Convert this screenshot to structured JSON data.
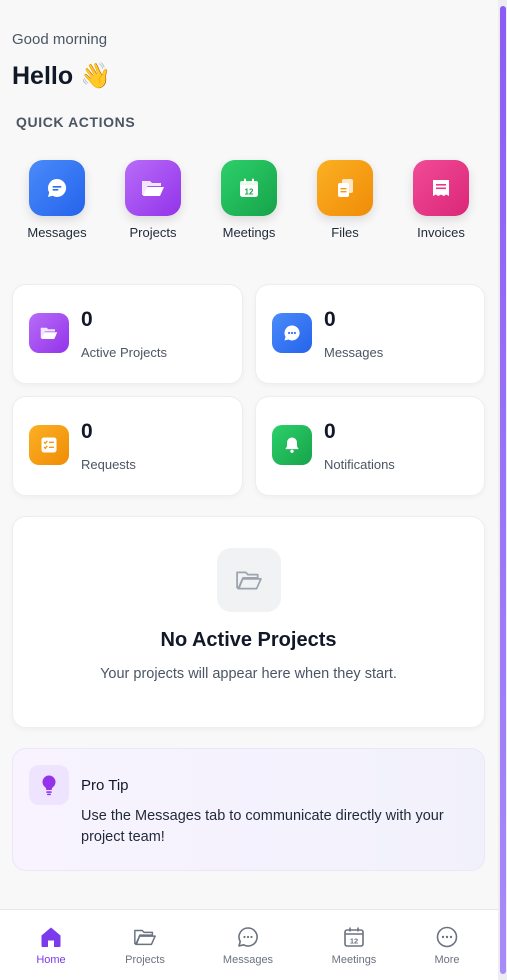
{
  "header": {
    "greeting": "Good morning",
    "hello": "Hello",
    "hello_emoji": "👋"
  },
  "quick_actions": {
    "title": "QUICK ACTIONS",
    "items": [
      {
        "label": "Messages",
        "icon": "chat-bubble-icon",
        "color": "#3b7cf6"
      },
      {
        "label": "Projects",
        "icon": "folder-open-icon",
        "color": "#a855f7"
      },
      {
        "label": "Meetings",
        "icon": "calendar-icon",
        "color": "#22c55e"
      },
      {
        "label": "Files",
        "icon": "files-icon",
        "color": "#f59e0b"
      },
      {
        "label": "Invoices",
        "icon": "invoice-icon",
        "color": "#ec4899"
      }
    ]
  },
  "stats": [
    {
      "value": "0",
      "label": "Active Projects",
      "icon": "folder-open-icon",
      "color": "#a855f7"
    },
    {
      "value": "0",
      "label": "Messages",
      "icon": "chat-bubble-icon",
      "color": "#3b7cf6"
    },
    {
      "value": "0",
      "label": "Requests",
      "icon": "checklist-icon",
      "color": "#f59e0b"
    },
    {
      "value": "0",
      "label": "Notifications",
      "icon": "bell-icon",
      "color": "#22c55e"
    }
  ],
  "empty_state": {
    "title": "No Active Projects",
    "subtitle": "Your projects will appear here when they start.",
    "icon": "folder-open-icon"
  },
  "tip": {
    "title": "Pro Tip",
    "body": "Use the Messages tab to communicate directly with your project team!",
    "icon": "lightbulb-icon"
  },
  "bottom_nav": {
    "items": [
      {
        "label": "Home",
        "icon": "home-icon",
        "active": true
      },
      {
        "label": "Projects",
        "icon": "folder-open-icon",
        "active": false
      },
      {
        "label": "Messages",
        "icon": "chat-bubble-icon",
        "active": false
      },
      {
        "label": "Meetings",
        "icon": "calendar-icon",
        "active": false
      },
      {
        "label": "More",
        "icon": "more-icon",
        "active": false
      }
    ],
    "active_color": "#7c3aed"
  },
  "calendar_day": "12"
}
